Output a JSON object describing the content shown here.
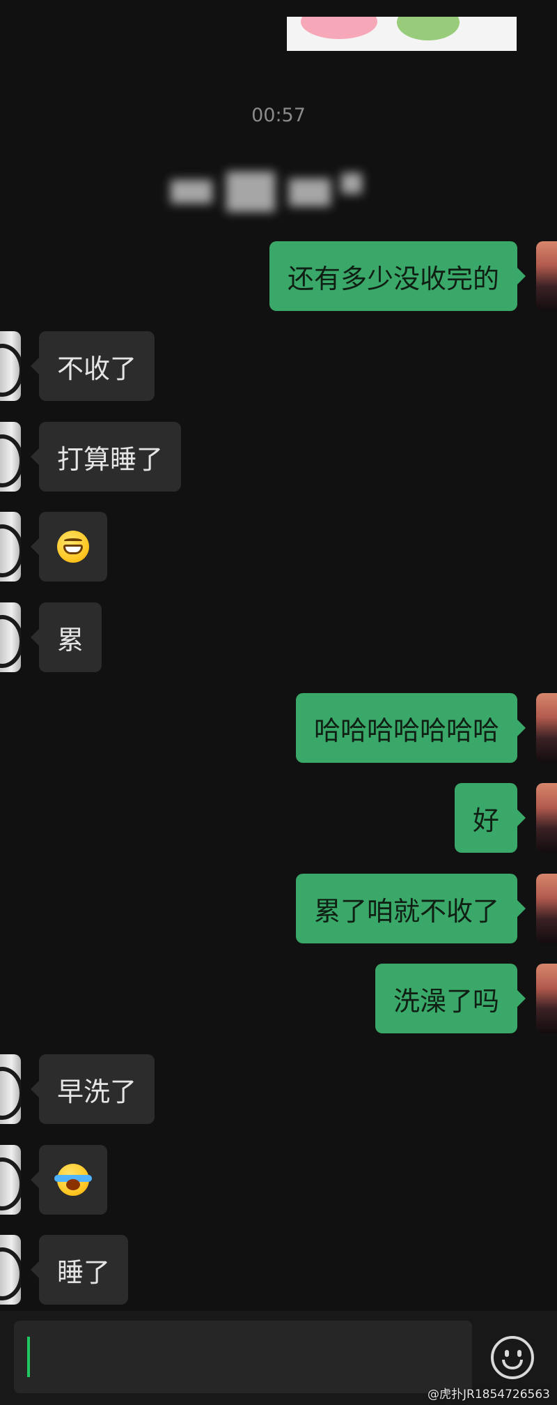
{
  "timestamp": "00:57",
  "messages": [
    {
      "side": "right",
      "type": "text",
      "text": "还有多少没收完的"
    },
    {
      "side": "left",
      "type": "text",
      "text": "不收了"
    },
    {
      "side": "left",
      "type": "text",
      "text": "打算睡了"
    },
    {
      "side": "left",
      "type": "emoji",
      "emoji": "grinning-face-icon"
    },
    {
      "side": "left",
      "type": "text",
      "text": "累"
    },
    {
      "side": "right",
      "type": "text",
      "text": "哈哈哈哈哈哈哈"
    },
    {
      "side": "right",
      "type": "text",
      "text": "好"
    },
    {
      "side": "right",
      "type": "text",
      "text": "累了咱就不收了"
    },
    {
      "side": "right",
      "type": "text",
      "text": "洗澡了吗"
    },
    {
      "side": "left",
      "type": "text",
      "text": "早洗了"
    },
    {
      "side": "left",
      "type": "emoji",
      "emoji": "loudly-crying-face-icon"
    },
    {
      "side": "left",
      "type": "text",
      "text": "睡了"
    }
  ],
  "input": {
    "value": ""
  },
  "watermark": "@虎扑JR1854726563",
  "colors": {
    "background": "#111111",
    "sent_bubble": "#3aa868",
    "received_bubble": "#2c2c2c",
    "cursor": "#1fc95f"
  }
}
